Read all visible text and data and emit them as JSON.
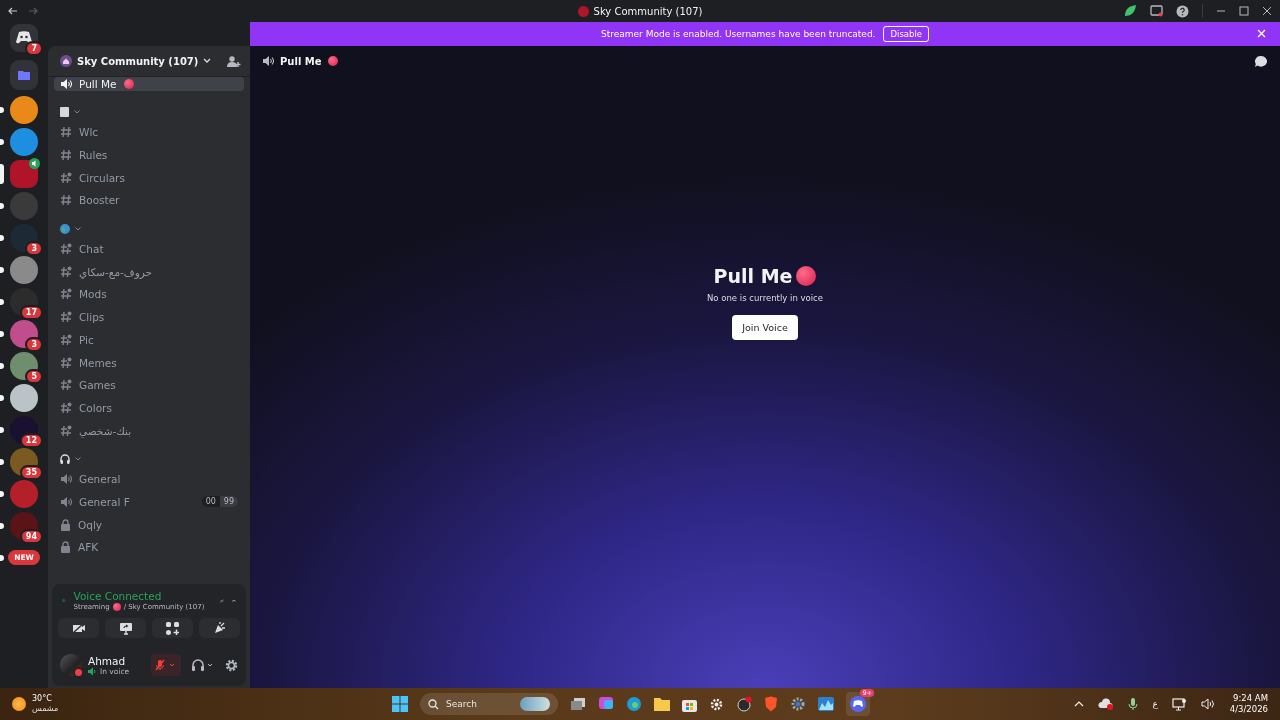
{
  "window": {
    "title": "Sky Community (107)"
  },
  "banner": {
    "text": "Streamer Mode is enabled. Usernames have been truncated.",
    "button": "Disable"
  },
  "home": {
    "badge": "7"
  },
  "servers": [
    {
      "color": "#e8891a",
      "unread": true,
      "selected": false
    },
    {
      "color": "#1e8fe0",
      "unread": true,
      "selected": false
    },
    {
      "color": "#b0142a",
      "unread": false,
      "selected": true,
      "voice": true
    },
    {
      "color": "#3a3a3a",
      "unread": true,
      "selected": false
    },
    {
      "color": "#1c2a36",
      "badge": "3",
      "unread": true,
      "selected": false
    },
    {
      "color": "#8a8a8a",
      "unread": true,
      "selected": false
    },
    {
      "color": "#2c2c2c",
      "badge": "17",
      "unread": true,
      "selected": false
    },
    {
      "color": "#c04d8c",
      "badge": "3",
      "unread": true,
      "selected": false
    },
    {
      "color": "#6e8e6e",
      "badge": "5",
      "unread": true,
      "selected": false
    },
    {
      "color": "#b9c3c8",
      "unread": true,
      "selected": false
    },
    {
      "color": "#1a1030",
      "badge": "12",
      "unread": true,
      "selected": false
    },
    {
      "color": "#7a5a20",
      "badge": "35",
      "unread": true,
      "selected": false
    },
    {
      "color": "#b3202a",
      "unread": true,
      "selected": false
    },
    {
      "color": "#5a1418",
      "badge": "94",
      "unread": true,
      "selected": false
    }
  ],
  "new_pill": "NEW",
  "server_header": {
    "name": "Sky Community (107)"
  },
  "channels": [
    {
      "kind": "voice",
      "name": "Pull Me",
      "selected": true
    },
    {
      "kind": "category"
    },
    {
      "kind": "text",
      "name": "Wlc",
      "selected": false
    },
    {
      "kind": "text",
      "name": "Rules",
      "selected": false
    },
    {
      "kind": "thread",
      "name": "Circulars",
      "selected": false
    },
    {
      "kind": "text",
      "name": "Booster",
      "selected": false
    },
    {
      "kind": "category"
    },
    {
      "kind": "thread",
      "name": "Chat",
      "selected": false
    },
    {
      "kind": "thread",
      "name": "حروف-مع-سكاي",
      "selected": false
    },
    {
      "kind": "thread",
      "name": "Mods",
      "selected": false
    },
    {
      "kind": "thread",
      "name": "Clips",
      "selected": false
    },
    {
      "kind": "thread",
      "name": "Pic",
      "selected": false
    },
    {
      "kind": "thread",
      "name": "Memes",
      "selected": false
    },
    {
      "kind": "thread",
      "name": "Games",
      "selected": false
    },
    {
      "kind": "thread",
      "name": "Colors",
      "selected": false
    },
    {
      "kind": "thread",
      "name": "بنك-شخصي",
      "selected": false
    },
    {
      "kind": "category"
    },
    {
      "kind": "voice",
      "name": "General",
      "selected": false
    },
    {
      "kind": "voice",
      "name": "General F",
      "selected": false,
      "limit": [
        "00",
        "99"
      ]
    },
    {
      "kind": "locked",
      "name": "Oqly",
      "selected": false
    },
    {
      "kind": "locked",
      "name": "AFK",
      "selected": false
    }
  ],
  "voice_panel": {
    "status": "Voice Connected",
    "detail": "Streaming",
    "server": "/ Sky Community (107)"
  },
  "user": {
    "name": "Ahmad",
    "status": "In voice",
    "muted": true
  },
  "channel_header": {
    "name": "Pull Me"
  },
  "empty_state": {
    "title": "Pull Me",
    "message": "No one is currently in voice",
    "button": "Join Voice"
  },
  "taskbar": {
    "temperature": "30°C",
    "condition": "مشمس",
    "search_placeholder": "Search",
    "discord_badge": "9+",
    "language": "ع",
    "time": "9:24 AM",
    "date": "4/3/2026"
  }
}
